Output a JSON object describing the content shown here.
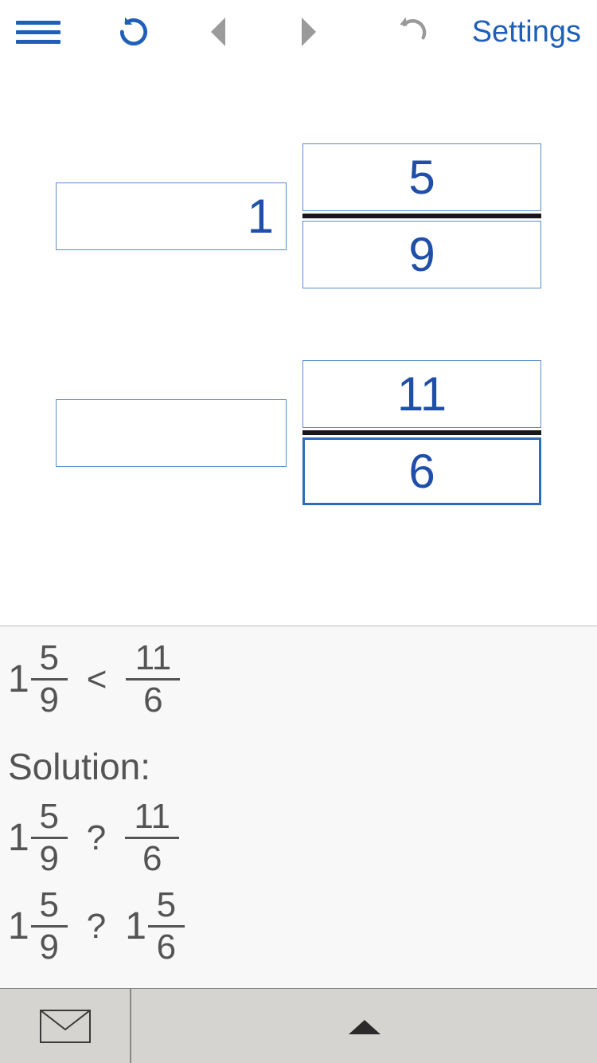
{
  "toolbar": {
    "settings_label": "Settings"
  },
  "input": {
    "row1": {
      "whole": "1",
      "num": "5",
      "den": "9"
    },
    "row2": {
      "whole": "",
      "num": "11",
      "den": "6"
    }
  },
  "solution": {
    "label": "Solution:",
    "result_row": {
      "left": {
        "whole": "1",
        "num": "5",
        "den": "9"
      },
      "op": "<",
      "right": {
        "num": "11",
        "den": "6"
      }
    },
    "steps": [
      {
        "left": {
          "whole": "1",
          "num": "5",
          "den": "9"
        },
        "op": "?",
        "right": {
          "num": "11",
          "den": "6"
        }
      },
      {
        "left": {
          "whole": "1",
          "num": "5",
          "den": "9"
        },
        "op": "?",
        "right": {
          "whole": "1",
          "num": "5",
          "den": "6"
        }
      }
    ]
  }
}
